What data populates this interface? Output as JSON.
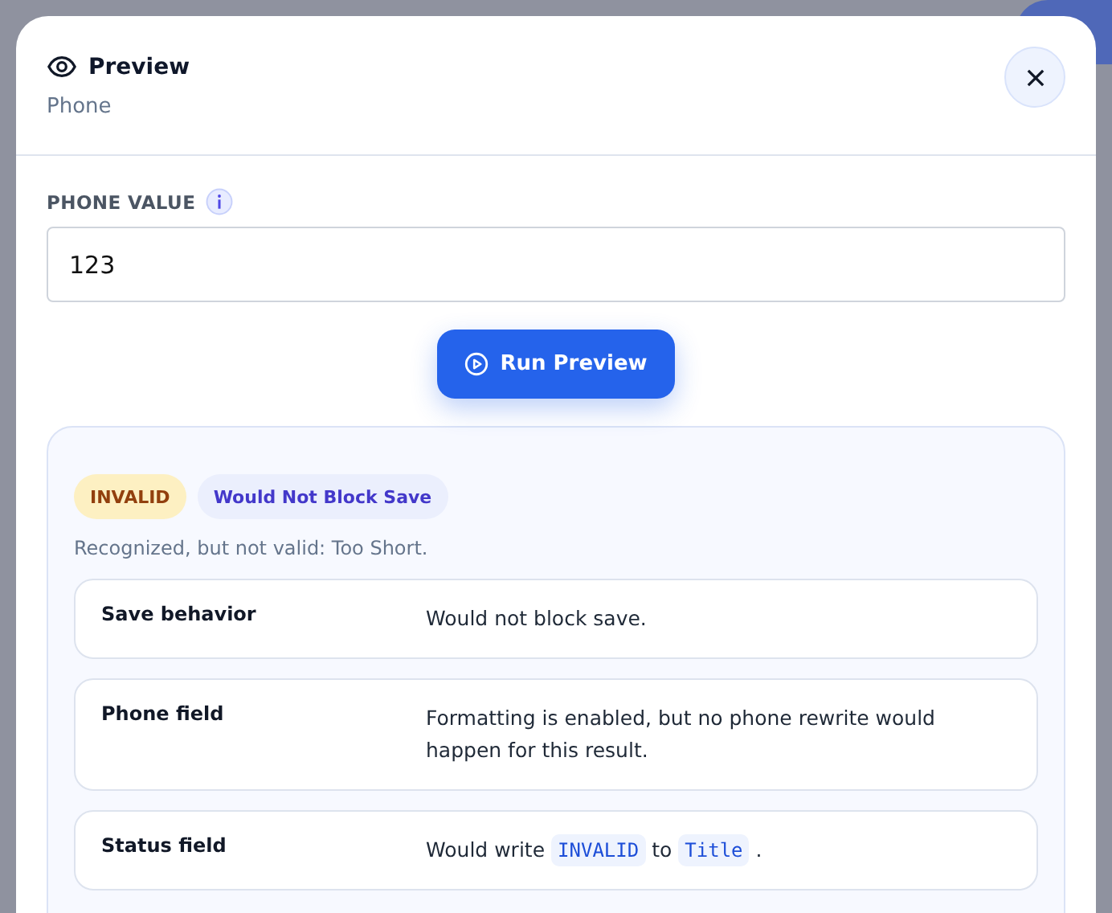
{
  "dialog": {
    "title": "Preview",
    "subtitle": "Phone"
  },
  "phone_value": {
    "label": "PHONE VALUE",
    "value": "123"
  },
  "run_button": {
    "label": "Run Preview"
  },
  "result": {
    "badges": [
      {
        "label": "INVALID",
        "kind": "warning"
      },
      {
        "label": "Would Not Block Save",
        "kind": "info"
      }
    ],
    "message": "Recognized, but not valid: Too Short.",
    "details": [
      {
        "label": "Save behavior",
        "value": [
          {
            "kind": "text",
            "text": "Would not block save."
          }
        ]
      },
      {
        "label": "Phone field",
        "value": [
          {
            "kind": "text",
            "text": "Formatting is enabled, but no phone rewrite would happen for this result."
          }
        ]
      },
      {
        "label": "Status field",
        "value": [
          {
            "kind": "text",
            "text": "Would write"
          },
          {
            "kind": "code",
            "text": "INVALID"
          },
          {
            "kind": "text",
            "text": "to"
          },
          {
            "kind": "code",
            "text": "Title"
          },
          {
            "kind": "text",
            "text": "."
          }
        ]
      }
    ]
  }
}
